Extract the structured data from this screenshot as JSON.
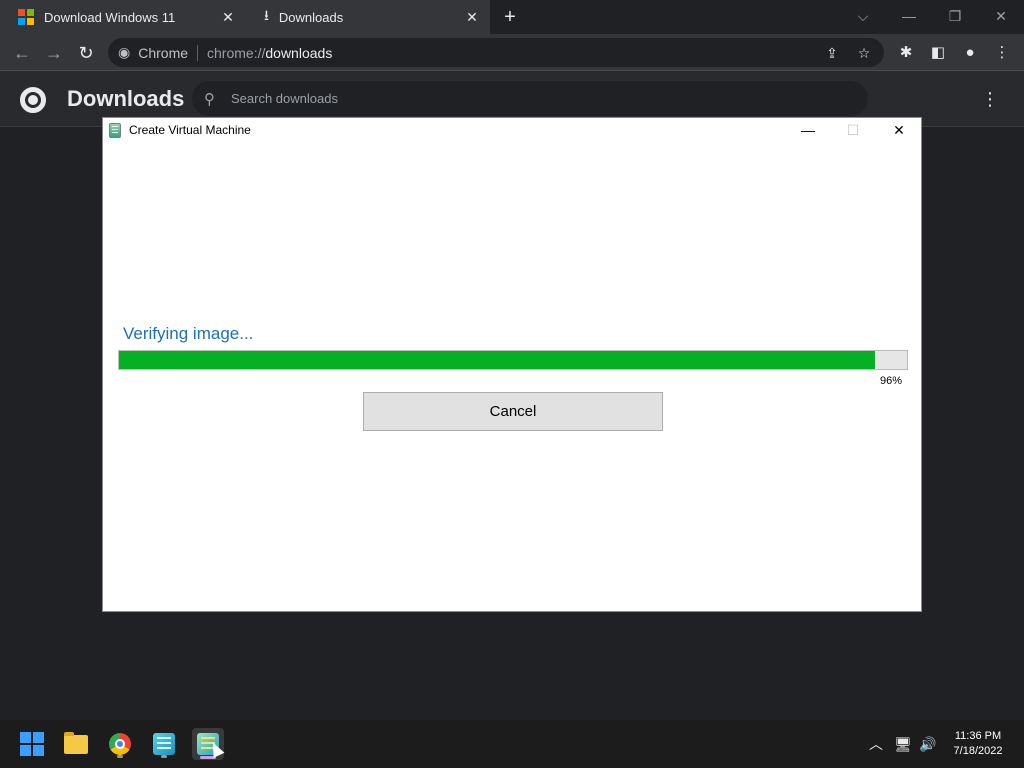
{
  "browser": {
    "tabs": [
      {
        "title": "Download Windows 11",
        "active": false,
        "icon": "windows-logo-icon"
      },
      {
        "title": "Downloads",
        "active": true,
        "icon": "download-icon"
      }
    ],
    "omnibox": {
      "site_label": "Chrome",
      "url_scheme": "chrome://",
      "url_host": "downloads"
    }
  },
  "downloads_page": {
    "title": "Downloads",
    "search_placeholder": "Search downloads"
  },
  "dialog": {
    "title": "Create Virtual Machine",
    "status": "Verifying image...",
    "progress_percent": 96,
    "progress_label": "96%",
    "cancel_label": "Cancel"
  },
  "taskbar": {
    "apps": [
      "start",
      "file-explorer",
      "chrome",
      "hyper-v-manager",
      "hyper-v-quick-create"
    ],
    "time": "11:36 PM",
    "date": "7/18/2022"
  },
  "colors": {
    "progress_fill": "#06b025",
    "status_text": "#1e70b4",
    "chrome_bg": "#202124"
  }
}
